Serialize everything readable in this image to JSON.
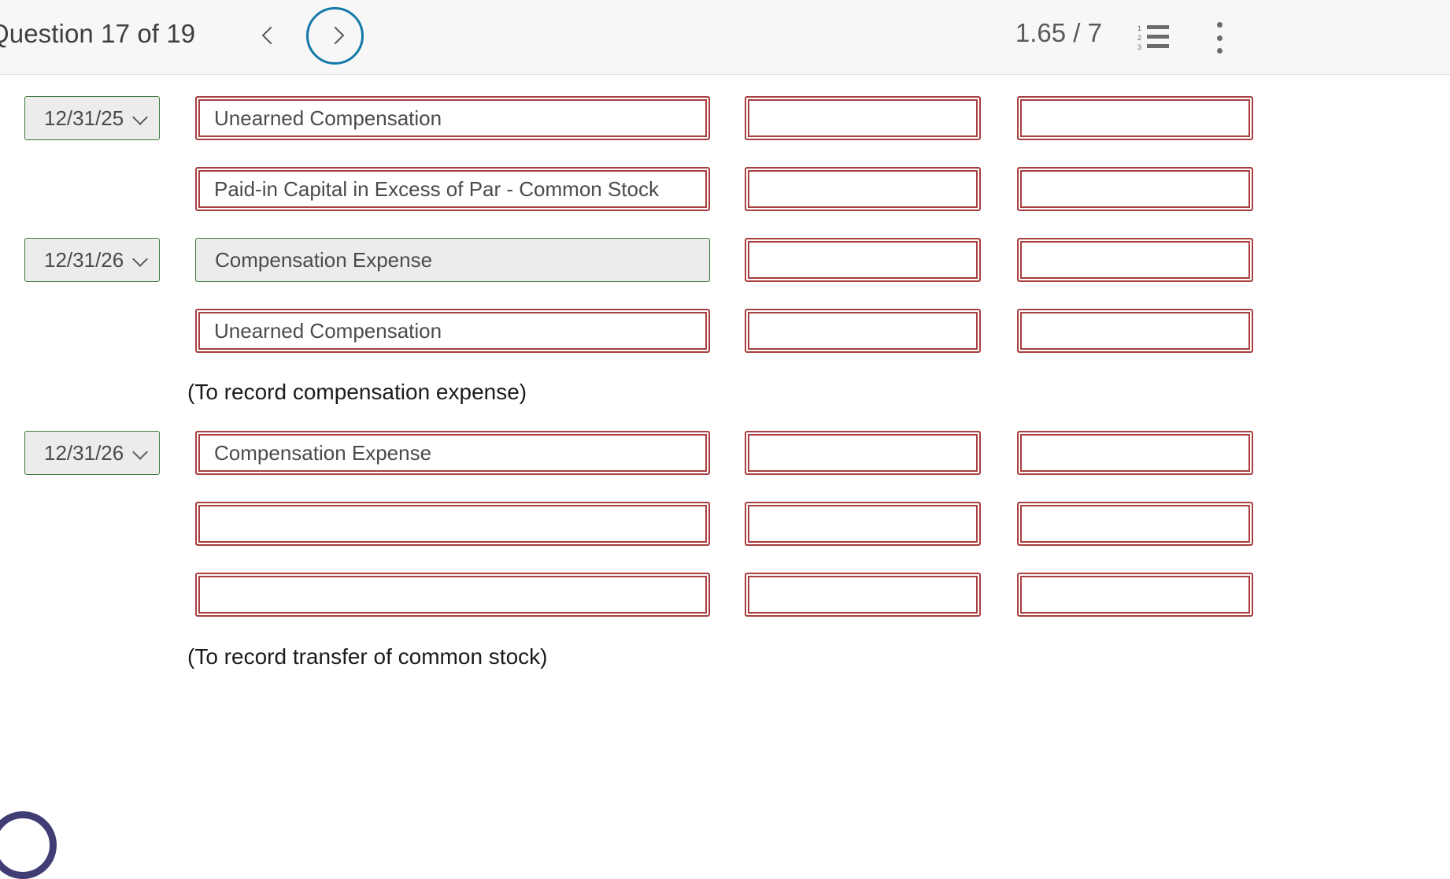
{
  "header": {
    "question_label": "Question 17 of 19",
    "prev_icon": "chevron-left-icon",
    "next_icon": "chevron-right-icon",
    "score": "1.65 / 7",
    "list_icon": "numbered-list-icon",
    "menu_icon": "kebab-menu-icon"
  },
  "colors": {
    "incorrect_border": "#a93f3f",
    "accepted_border": "#3c7a3e",
    "accepted_fill": "#ececec",
    "next_ring": "#1278a8",
    "header_bg": "#f7f7f7",
    "corner_arc": "#3f3d74"
  },
  "journal": {
    "rows": [
      {
        "date": "12/31/25",
        "has_date": true,
        "account": "Unearned Compensation",
        "account_state": "incorrect",
        "debit": "",
        "credit": ""
      },
      {
        "date": "",
        "has_date": false,
        "account": "Paid-in Capital in Excess of Par - Common Stock",
        "account_state": "incorrect",
        "debit": "",
        "credit": ""
      },
      {
        "date": "12/31/26",
        "has_date": true,
        "account": "Compensation Expense",
        "account_state": "accepted",
        "debit": "",
        "credit": ""
      },
      {
        "date": "",
        "has_date": false,
        "account": "Unearned Compensation",
        "account_state": "incorrect",
        "debit": "",
        "credit": ""
      },
      {
        "date": "12/31/26",
        "has_date": true,
        "account": "Compensation Expense",
        "account_state": "incorrect",
        "debit": "",
        "credit": ""
      },
      {
        "date": "",
        "has_date": false,
        "account": "",
        "account_state": "incorrect",
        "debit": "",
        "credit": ""
      },
      {
        "date": "",
        "has_date": false,
        "account": "",
        "account_state": "incorrect",
        "debit": "",
        "credit": ""
      }
    ],
    "captions": [
      "(To record compensation expense)",
      "(To record transfer of common stock)"
    ]
  }
}
